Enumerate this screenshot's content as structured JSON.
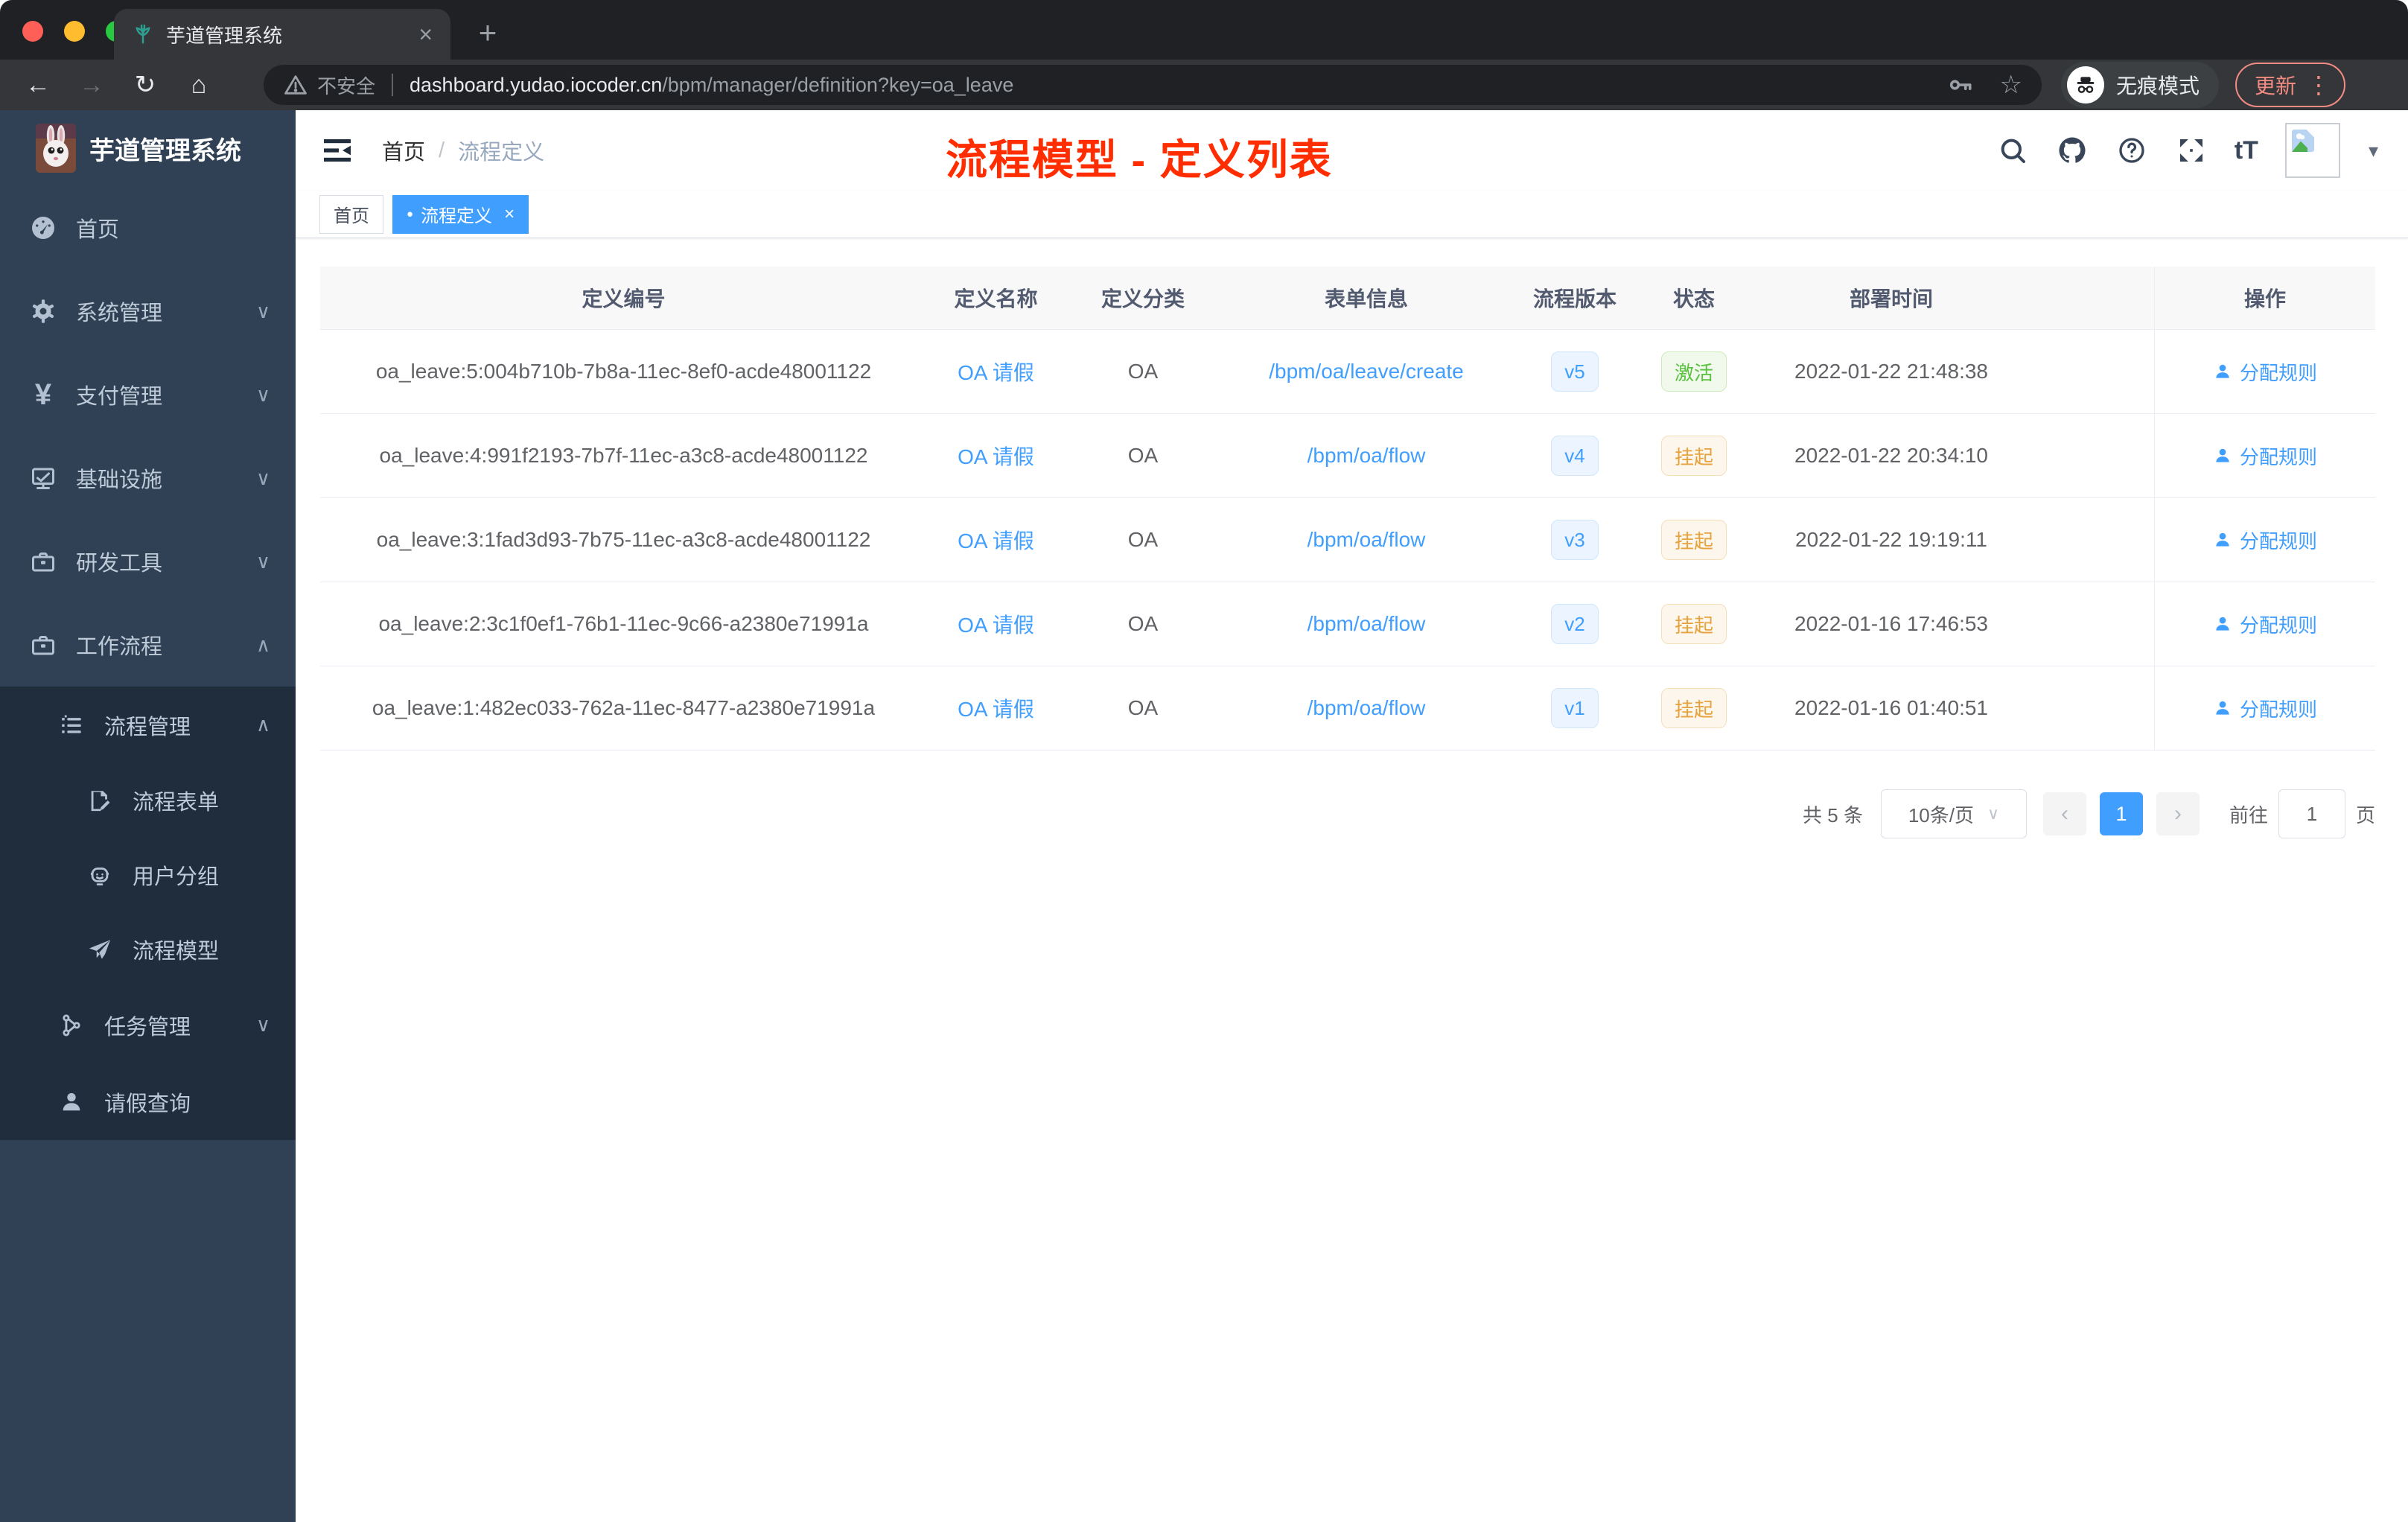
{
  "browser": {
    "tab_title": "芋道管理系统",
    "url_warning": "不安全",
    "url_domain": "dashboard.yudao.iocoder.cn",
    "url_path": "/bpm/manager/definition?key=oa_leave",
    "incognito_label": "无痕模式",
    "update_label": "更新"
  },
  "icons": {
    "close": "×",
    "plus": "+",
    "back": "←",
    "forward": "→",
    "reload": "↻",
    "home": "⌂",
    "star": "☆",
    "kebab": "⋮",
    "caret_down": "▾",
    "chevron_down": "∨",
    "chevron_up": "∧",
    "dot": "●",
    "yen": "¥",
    "font_size": "tT",
    "breadcrumb_sep": "/",
    "prev": "‹",
    "next": "›",
    "select_caret": "∨",
    "tag_close": "×"
  },
  "sidebar": {
    "title": "芋道管理系统",
    "items": [
      {
        "label": "首页"
      },
      {
        "label": "系统管理"
      },
      {
        "label": "支付管理"
      },
      {
        "label": "基础设施"
      },
      {
        "label": "研发工具"
      },
      {
        "label": "工作流程"
      },
      {
        "label": "流程管理"
      },
      {
        "label": "流程表单"
      },
      {
        "label": "用户分组"
      },
      {
        "label": "流程模型"
      },
      {
        "label": "任务管理"
      },
      {
        "label": "请假查询"
      }
    ]
  },
  "header": {
    "breadcrumb": [
      "首页",
      "流程定义"
    ],
    "annotation": "流程模型 - 定义列表"
  },
  "tags": [
    {
      "label": "首页"
    },
    {
      "label": "流程定义"
    }
  ],
  "table": {
    "columns": [
      "定义编号",
      "定义名称",
      "定义分类",
      "表单信息",
      "流程版本",
      "状态",
      "部署时间",
      "操作"
    ],
    "rows": [
      {
        "id": "oa_leave:5:004b710b-7b8a-11ec-8ef0-acde48001122",
        "name": "OA 请假",
        "category": "OA",
        "form": "/bpm/oa/leave/create",
        "version": "v5",
        "status": "激活",
        "time": "2022-01-22 21:48:38",
        "action": "分配规则"
      },
      {
        "id": "oa_leave:4:991f2193-7b7f-11ec-a3c8-acde48001122",
        "name": "OA 请假",
        "category": "OA",
        "form": "/bpm/oa/flow",
        "version": "v4",
        "status": "挂起",
        "time": "2022-01-22 20:34:10",
        "action": "分配规则"
      },
      {
        "id": "oa_leave:3:1fad3d93-7b75-11ec-a3c8-acde48001122",
        "name": "OA 请假",
        "category": "OA",
        "form": "/bpm/oa/flow",
        "version": "v3",
        "status": "挂起",
        "time": "2022-01-22 19:19:11",
        "action": "分配规则"
      },
      {
        "id": "oa_leave:2:3c1f0ef1-76b1-11ec-9c66-a2380e71991a",
        "name": "OA 请假",
        "category": "OA",
        "form": "/bpm/oa/flow",
        "version": "v2",
        "status": "挂起",
        "time": "2022-01-16 17:46:53",
        "action": "分配规则"
      },
      {
        "id": "oa_leave:1:482ec033-762a-11ec-8477-a2380e71991a",
        "name": "OA 请假",
        "category": "OA",
        "form": "/bpm/oa/flow",
        "version": "v1",
        "status": "挂起",
        "time": "2022-01-16 01:40:51",
        "action": "分配规则"
      }
    ]
  },
  "pagination": {
    "total": "共 5 条",
    "page_size": "10条/页",
    "current_page": "1",
    "goto_label": "前往",
    "goto_value": "1",
    "unit_label": "页"
  },
  "colors": {
    "accent": "#409eff",
    "sidebar_bg": "#304156",
    "submenu_bg": "#1f2d3d",
    "success": "#67c23a",
    "warning": "#e6a23c",
    "annotation_red": "#ff2d00"
  }
}
